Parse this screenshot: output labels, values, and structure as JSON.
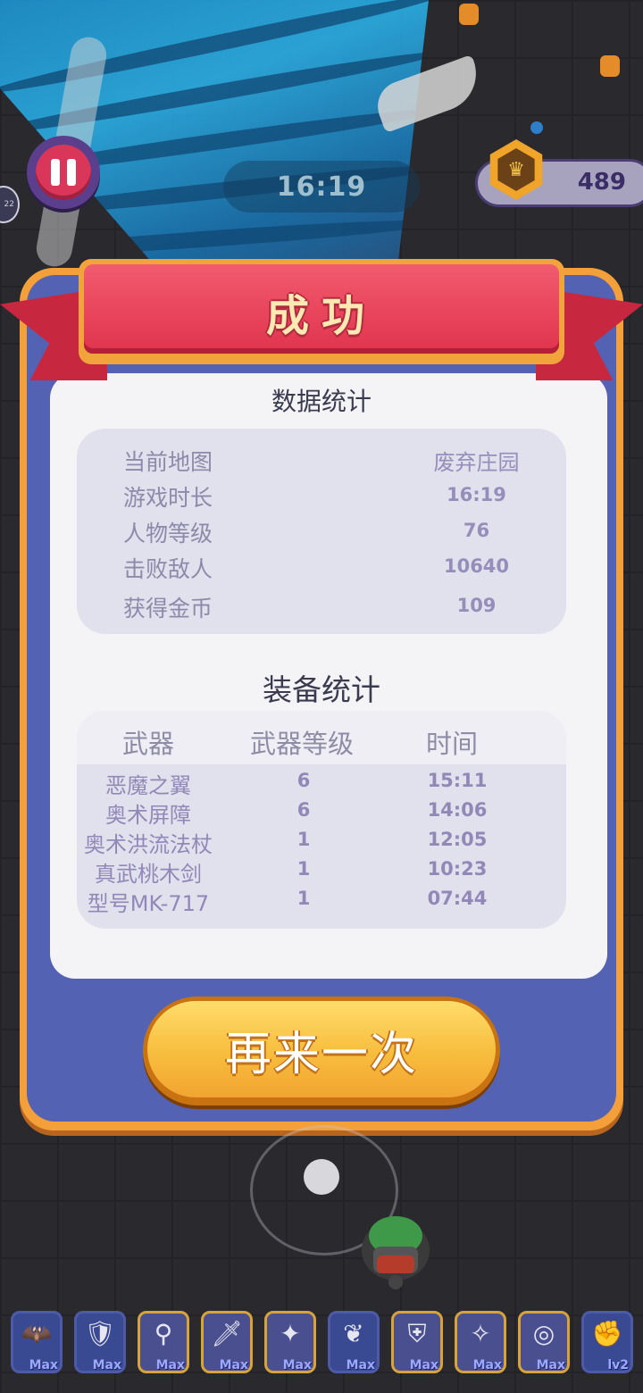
{
  "hud": {
    "timer": "16:19",
    "coins": "489",
    "side_badge": "22"
  },
  "result": {
    "title": "成功",
    "stats_title": "数据统计",
    "stats": [
      {
        "label": "当前地图",
        "value": "废弃庄园"
      },
      {
        "label": "游戏时长",
        "value": "16:19"
      },
      {
        "label": "人物等级",
        "value": "76"
      },
      {
        "label": "击败敌人",
        "value": "10640"
      },
      {
        "label": "获得金币",
        "value": "109"
      }
    ],
    "equip_title": "装备统计",
    "equip_headers": [
      "武器",
      "武器等级",
      "时间"
    ],
    "equipment": [
      {
        "name": "恶魔之翼",
        "level": "6",
        "time": "15:11"
      },
      {
        "name": "奥术屏障",
        "level": "6",
        "time": "14:06"
      },
      {
        "name": "奥术洪流法杖",
        "level": "1",
        "time": "12:05"
      },
      {
        "name": "真武桃木剑",
        "level": "1",
        "time": "10:23"
      },
      {
        "name": "型号MK-717",
        "level": "1",
        "time": "07:44"
      }
    ],
    "retry_label": "再来一次"
  },
  "skills": [
    {
      "icon": "demon-wings-icon",
      "glyph": "🦇",
      "level": "Max",
      "frame": "blue"
    },
    {
      "icon": "arcane-shield-icon",
      "glyph": "🛡",
      "level": "Max",
      "frame": "blue"
    },
    {
      "icon": "arcane-staff-icon",
      "glyph": "⚲",
      "level": "Max",
      "frame": "gold"
    },
    {
      "icon": "sword-icon",
      "glyph": "🗡",
      "level": "Max",
      "frame": "gold"
    },
    {
      "icon": "gun-icon",
      "glyph": "✦",
      "level": "Max",
      "frame": "gold"
    },
    {
      "icon": "wings-icon",
      "glyph": "❦",
      "level": "Max",
      "frame": "blue"
    },
    {
      "icon": "armor-icon",
      "glyph": "⛨",
      "level": "Max",
      "frame": "gold"
    },
    {
      "icon": "boot-icon",
      "glyph": "✧",
      "level": "Max",
      "frame": "gold"
    },
    {
      "icon": "ring-icon",
      "glyph": "◎",
      "level": "Max",
      "frame": "gold"
    },
    {
      "icon": "gauntlet-icon",
      "glyph": "✊",
      "level": "lv2",
      "frame": "blue"
    }
  ],
  "colors": {
    "panel_frame": "#f3a03a",
    "panel_body": "#5462b4",
    "ribbon": "#e0334d",
    "retry_button": "#f7bd3d",
    "value_text": "#958dba"
  }
}
